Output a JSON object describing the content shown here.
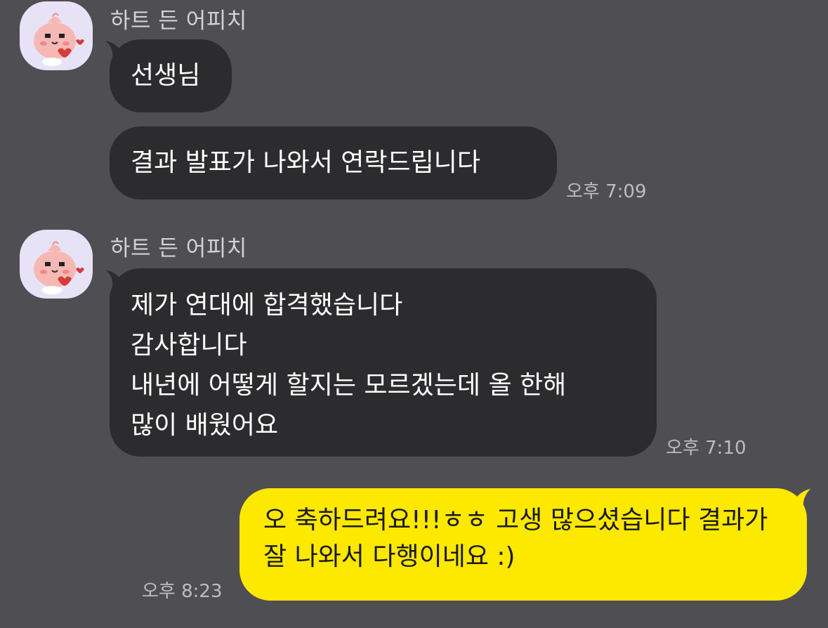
{
  "chat": {
    "groups": [
      {
        "sender": "하트 든 어피치",
        "messages": [
          "선생님",
          "결과 발표가 나와서 연락드립니다"
        ],
        "time": "오후 7:09"
      },
      {
        "sender": "하트 든 어피치",
        "messages": [
          "제가 연대에 합격했습니다\n감사합니다\n내년에 어떻게 할지는 모르겠는데 올 한해\n많이 배웠어요"
        ],
        "time": "오후 7:10"
      }
    ],
    "mine": {
      "message": "오 축하드려요!!!ㅎㅎ 고생 많으셨습니다 결과가 잘 나와서 다행이네요 :)",
      "time": "오후 8:23"
    }
  },
  "colors": {
    "background": "#4f4e53",
    "incoming_bubble": "#2c2c2e",
    "outgoing_bubble": "#fde800",
    "avatar_bg": "#e8e2f7"
  },
  "icons": {
    "avatar": "apeach-heart-avatar-icon"
  }
}
